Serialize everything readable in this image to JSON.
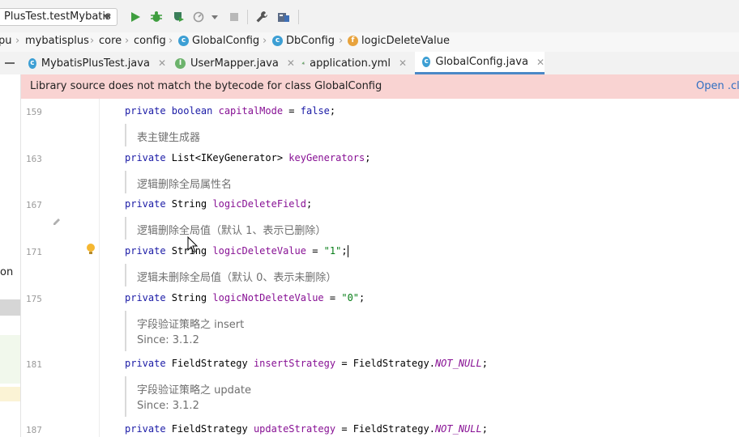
{
  "toolbar": {
    "run_config": "PlusTest.testMybatis"
  },
  "breadcrumbs": {
    "items": [
      "pu",
      "mybatisplus",
      "core",
      "config",
      "GlobalConfig",
      "DbConfig",
      "logicDeleteValue"
    ]
  },
  "tabs": [
    {
      "label": "MybatisPlusTest.java",
      "active": false
    },
    {
      "label": "UserMapper.java",
      "active": false
    },
    {
      "label": "application.yml",
      "active": false
    },
    {
      "label": "GlobalConfig.java",
      "active": true
    }
  ],
  "banner": {
    "message": "Library source does not match the bytecode for class GlobalConfig",
    "link": "Open .cl"
  },
  "left_panel": {
    "fragment": "on"
  },
  "editor": {
    "line_numbers": [
      "159",
      "163",
      "167",
      "171",
      "175",
      "181",
      "187"
    ],
    "docs": {
      "d1": "表主键生成器",
      "d2": "逻辑删除全局属性名",
      "d3": "逻辑删除全局值（默认 1、表示已删除）",
      "d4": "逻辑未删除全局值（默认 0、表示未删除）",
      "d5": "字段验证策略之 insert",
      "d5_since": "Since: 3.1.2",
      "d6": "字段验证策略之 update",
      "d6_since": "Since: 3.1.2"
    },
    "code": {
      "l1": {
        "kw": "private boolean ",
        "field": "capitalMode",
        "mid": " = ",
        "val": "false",
        "end": ";"
      },
      "l2": {
        "kw": "private ",
        "type": "List<IKeyGenerator> ",
        "field": "keyGenerators",
        "end": ";"
      },
      "l3": {
        "kw": "private ",
        "type": "String ",
        "field": "logicDeleteField",
        "end": ";"
      },
      "l4": {
        "kw": "private ",
        "type": "String ",
        "field": "logicDeleteValue",
        "mid": " = ",
        "val": "\"1\"",
        "end": ";"
      },
      "l5": {
        "kw": "private ",
        "type": "String ",
        "field": "logicNotDeleteValue",
        "mid": " = ",
        "val": "\"0\"",
        "end": ";"
      },
      "l6": {
        "kw": "private ",
        "type": "FieldStrategy ",
        "field": "insertStrategy",
        "mid": " = FieldStrategy.",
        "val": "NOT_NULL",
        "end": ";"
      },
      "l7": {
        "kw": "private ",
        "type": "FieldStrategy ",
        "field": "updateStrategy",
        "mid": " = FieldStrategy.",
        "val": "NOT_NULL",
        "end": ";"
      }
    }
  },
  "colors": {
    "banner_bg": "#f9d3d2",
    "keyword": "#1a1aa6",
    "field": "#871094",
    "string": "#067d17",
    "active_tab_underline": "#4a88c7"
  }
}
